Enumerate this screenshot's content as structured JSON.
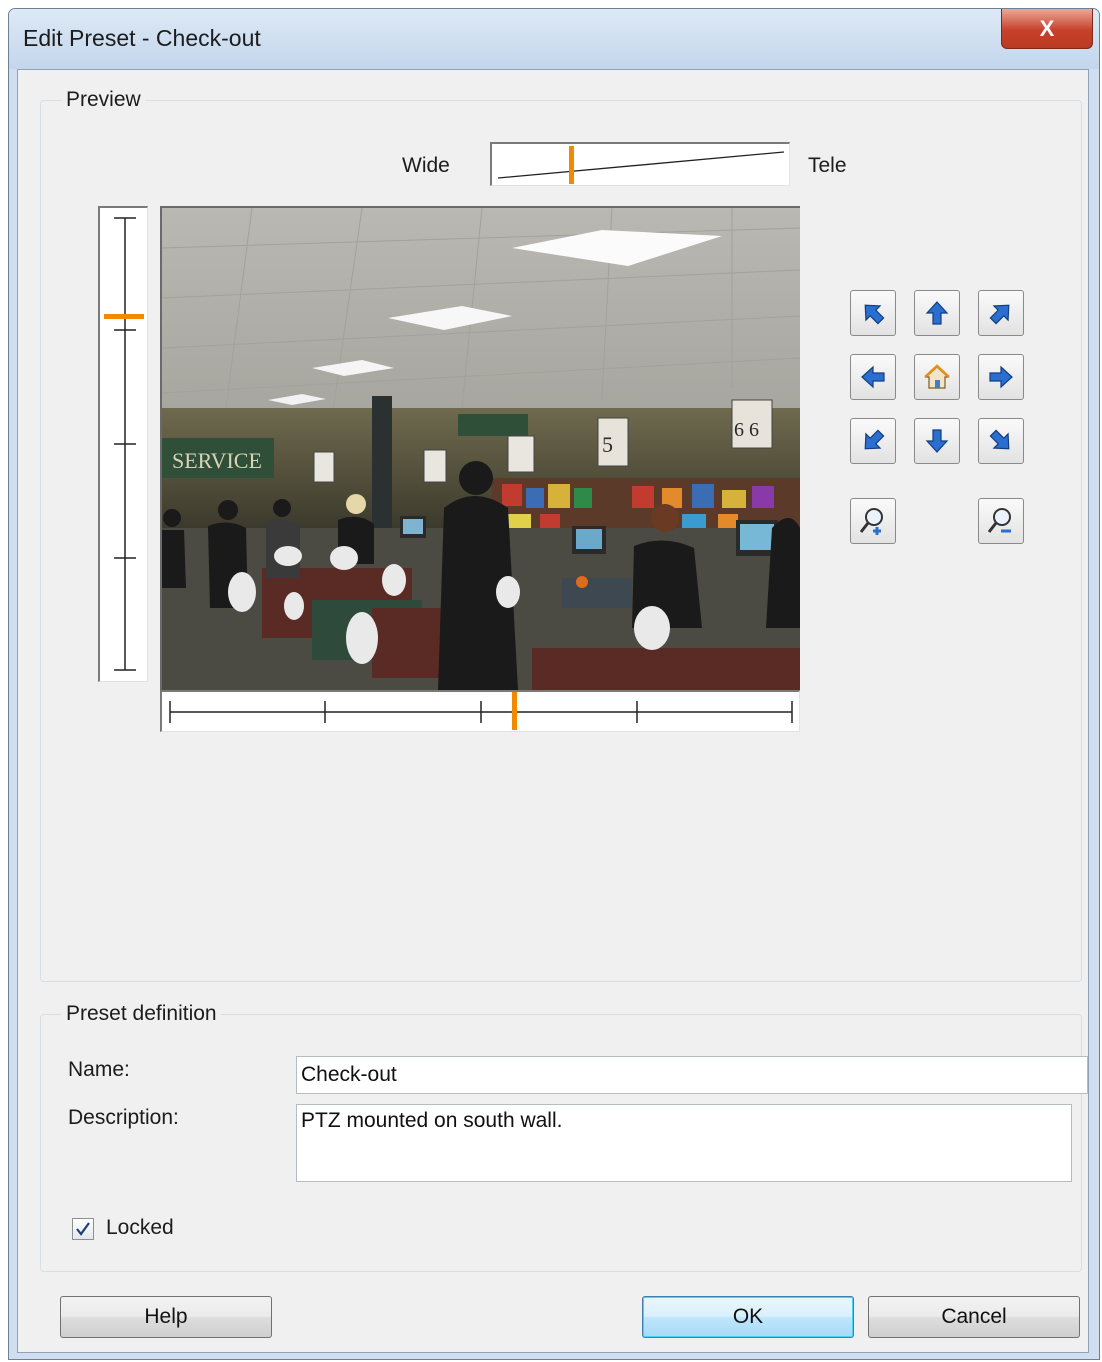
{
  "window": {
    "title": "Edit Preset - Check-out",
    "close_glyph": "X"
  },
  "preview": {
    "legend": "Preview",
    "zoom": {
      "wide_label": "Wide",
      "tele_label": "Tele",
      "position": 0.26
    },
    "tilt": {
      "position": 0.22
    },
    "pan": {
      "position": 0.55
    },
    "image_caption_service": "SERVICE",
    "image_lane_5": "5",
    "image_lane_6": "6 6",
    "ptz_buttons": [
      "pan-up-left",
      "tilt-up",
      "pan-up-right",
      "pan-left",
      "home",
      "pan-right",
      "pan-down-left",
      "tilt-down",
      "pan-down-right",
      "zoom-in",
      "zoom-out"
    ]
  },
  "definition": {
    "legend": "Preset definition",
    "name_label": "Name:",
    "name_value": "Check-out",
    "description_label": "Description:",
    "description_value": "PTZ mounted on south wall.",
    "locked_label": "Locked",
    "locked_checked": true
  },
  "buttons": {
    "help": "Help",
    "ok": "OK",
    "cancel": "Cancel"
  },
  "colors": {
    "marker": "#f08a00",
    "accent_blue": "#2a6fd0"
  }
}
